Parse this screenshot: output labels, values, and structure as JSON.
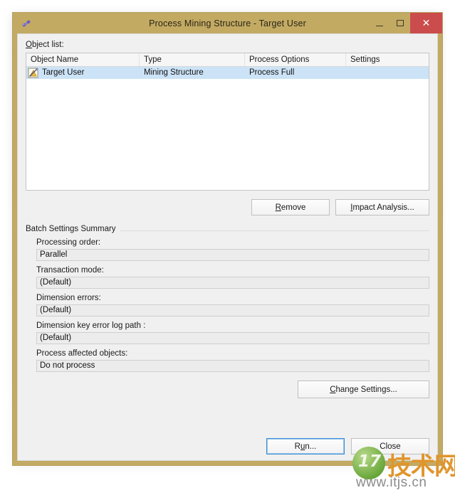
{
  "window": {
    "title": "Process Mining Structure - Target User",
    "icon": "mining-structure-icon",
    "controls": {
      "minimize": "minimize-icon",
      "maximize": "maximize-icon",
      "close": "✕"
    }
  },
  "object_list": {
    "label": "Object list:",
    "columns": [
      "Object Name",
      "Type",
      "Process Options",
      "Settings"
    ],
    "rows": [
      {
        "icon": "mining-structure-item-icon",
        "object_name": "Target User",
        "type": "Mining Structure",
        "process_options": "Process Full",
        "settings": ""
      }
    ]
  },
  "list_buttons": {
    "remove": "Remove",
    "impact_analysis": "Impact Analysis..."
  },
  "batch_settings": {
    "group_title": "Batch Settings Summary",
    "fields": [
      {
        "label": "Processing order:",
        "value": "Parallel"
      },
      {
        "label": "Transaction mode:",
        "value": "(Default)"
      },
      {
        "label": "Dimension errors:",
        "value": "(Default)"
      },
      {
        "label": "Dimension key error log path :",
        "value": "(Default)"
      },
      {
        "label": "Process affected objects:",
        "value": "Do not process"
      }
    ],
    "change_settings": "Change Settings..."
  },
  "footer": {
    "run": "Run...",
    "close": "Close"
  },
  "watermark": {
    "badge": "17",
    "chinese": "技术网",
    "url": "www.itjs.cn"
  },
  "colors": {
    "titlebar": "#c3aa63",
    "close_button": "#cb4c4c",
    "selection": "#cce3f7",
    "dialog_bg": "#f0f0f0",
    "default_button_border": "#3c8cd4"
  }
}
